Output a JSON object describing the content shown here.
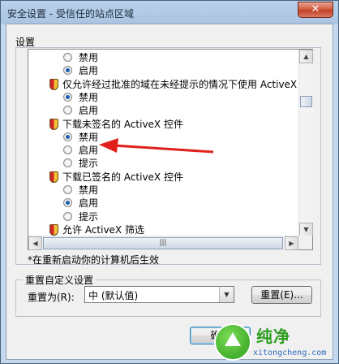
{
  "window": {
    "title": "安全设置 - 受信任的站点区域"
  },
  "settings": {
    "group_label": "设置",
    "items": [
      {
        "type": "radio",
        "label": "禁用",
        "checked": false
      },
      {
        "type": "radio",
        "label": "启用",
        "checked": true
      },
      {
        "type": "header",
        "label": "仅允许经过批准的域在未经提示的情况下使用 ActiveX"
      },
      {
        "type": "radio",
        "label": "禁用",
        "checked": true
      },
      {
        "type": "radio",
        "label": "启用",
        "checked": false
      },
      {
        "type": "header",
        "label": "下载未签名的 ActiveX 控件"
      },
      {
        "type": "radio",
        "label": "禁用",
        "checked": true
      },
      {
        "type": "radio",
        "label": "启用",
        "checked": false
      },
      {
        "type": "radio",
        "label": "提示",
        "checked": false
      },
      {
        "type": "header",
        "label": "下载已签名的 ActiveX 控件"
      },
      {
        "type": "radio",
        "label": "禁用",
        "checked": false
      },
      {
        "type": "radio",
        "label": "启用",
        "checked": true
      },
      {
        "type": "radio",
        "label": "提示",
        "checked": false
      },
      {
        "type": "header",
        "label": "允许 ActiveX 筛选"
      }
    ],
    "note": "*在重新启动你的计算机后生效"
  },
  "reset": {
    "group_label": "重置自定义设置",
    "label": "重置为(R):",
    "selected": "中 (默认值)",
    "button": "重置(E)..."
  },
  "buttons": {
    "ok": "确定"
  },
  "watermark": {
    "text1": "纯净",
    "text2": "xitongcheng.com"
  },
  "colors": {
    "annotation_arrow": "#e0201b",
    "radio_dot": "#1b5fb2"
  }
}
